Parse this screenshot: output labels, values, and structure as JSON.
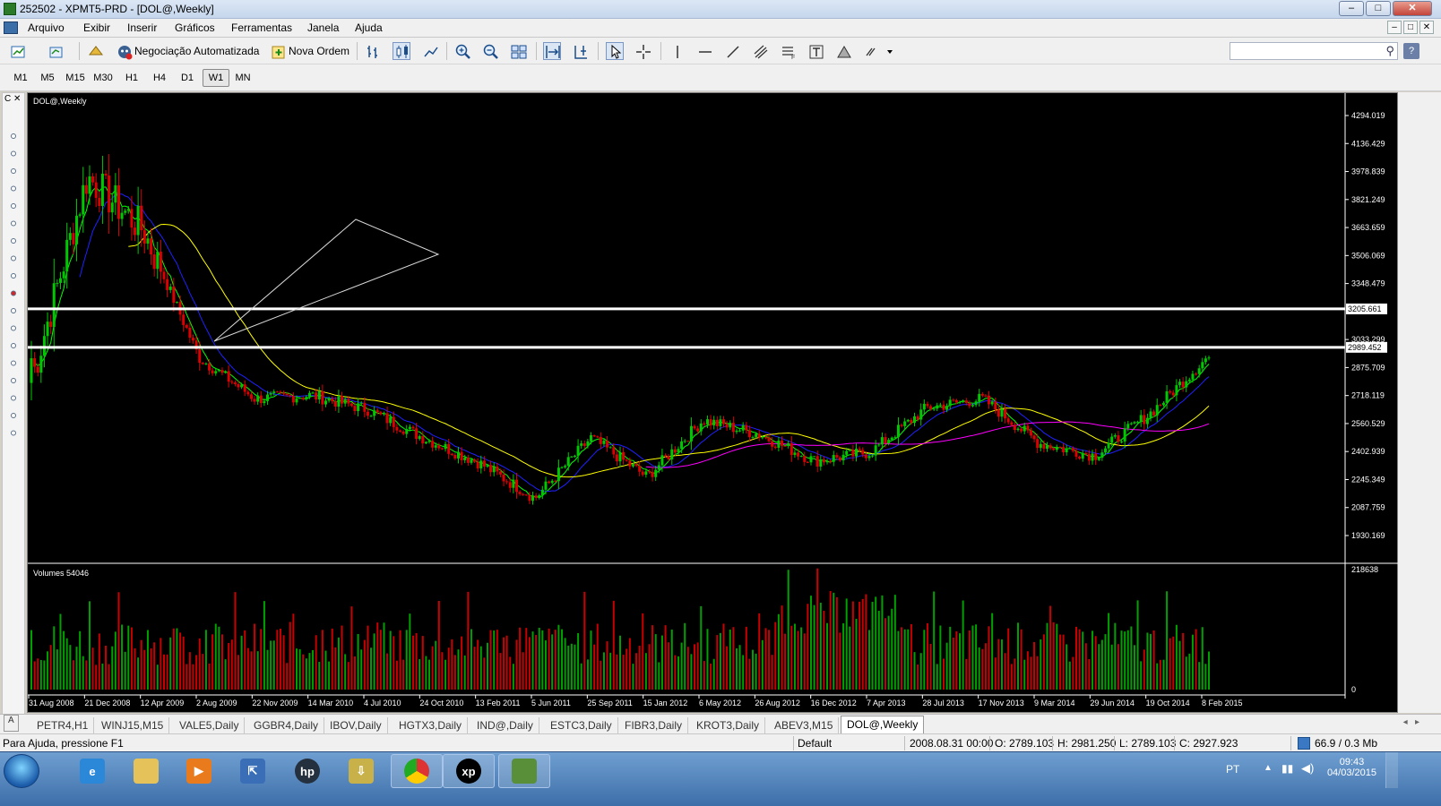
{
  "window": {
    "title": "252502 - XPMT5-PRD - [DOL@,Weekly]",
    "btn_minimize": "–",
    "btn_maximize": "□",
    "btn_close": "✕"
  },
  "menu": [
    "Arquivo",
    "Exibir",
    "Inserir",
    "Gráficos",
    "Ferramentas",
    "Janela",
    "Ajuda"
  ],
  "toolbar": {
    "auto_trading_label": "Negociação Automatizada",
    "new_order_label": "Nova Ordem",
    "search_placeholder": ""
  },
  "timeframes": [
    "M1",
    "M5",
    "M15",
    "M30",
    "H1",
    "H4",
    "D1",
    "W1",
    "MN"
  ],
  "active_timeframe": "W1",
  "chart": {
    "symbol_label": "DOL@,Weekly",
    "volume_label": "Volumes 54046",
    "price_ticks": [
      "4294.019",
      "4136.429",
      "3978.839",
      "3821.249",
      "3663.659",
      "3506.069",
      "3348.479",
      "3033.299",
      "2875.709",
      "2718.119",
      "2560.529",
      "2402.939",
      "2245.349",
      "2087.759",
      "1930.169"
    ],
    "price_tick_values": [
      4294.019,
      4136.429,
      3978.839,
      3821.249,
      3663.659,
      3506.069,
      3348.479,
      3033.299,
      2875.709,
      2718.119,
      2560.529,
      2402.939,
      2245.349,
      2087.759,
      1930.169
    ],
    "hline_labels": [
      "3205.661",
      "2989.452"
    ],
    "hline_values": [
      3205.661,
      2989.452
    ],
    "volume_max_label": "218638",
    "volume_min_label": "0",
    "date_labels": [
      "31 Aug 2008",
      "21 Dec 2008",
      "12 Apr 2009",
      "2 Aug 2009",
      "22 Nov 2009",
      "14 Mar 2010",
      "4 Jul 2010",
      "24 Oct 2010",
      "13 Feb 2011",
      "5 Jun 2011",
      "25 Sep 2011",
      "15 Jan 2012",
      "6 May 2012",
      "26 Aug 2012",
      "16 Dec 2012",
      "7 Apr 2013",
      "28 Jul 2013",
      "17 Nov 2013",
      "9 Mar 2014",
      "29 Jun 2014",
      "19 Oct 2014",
      "8 Feb 2015"
    ],
    "colors": {
      "background": "#000000",
      "bull": "#00c800",
      "bear": "#dc0000",
      "ma_fast": "#00ff00",
      "ma_mid": "#2020ff",
      "ma_slow": "#ffff00",
      "ma_long": "#ff00ff",
      "hline": "#ffffff",
      "volume_bull": "#00a000",
      "volume_bear": "#c80000"
    }
  },
  "chart_data": {
    "type": "candlestick",
    "symbol": "DOL@",
    "timeframe": "Weekly",
    "ylim": [
      1900,
      4400
    ],
    "anchor_closes": [
      {
        "date": "31 Aug 2008",
        "close": 2800
      },
      {
        "date": "21 Dec 2008",
        "close": 3950
      },
      {
        "date": "12 Apr 2009",
        "close": 3650
      },
      {
        "date": "2 Aug 2009",
        "close": 2930
      },
      {
        "date": "22 Nov 2009",
        "close": 2700
      },
      {
        "date": "14 Mar 2010",
        "close": 2720
      },
      {
        "date": "4 Jul 2010",
        "close": 2640
      },
      {
        "date": "24 Oct 2010",
        "close": 2480
      },
      {
        "date": "13 Feb 2011",
        "close": 2340
      },
      {
        "date": "5 Jun 2011",
        "close": 2140
      },
      {
        "date": "25 Sep 2011",
        "close": 2480
      },
      {
        "date": "15 Jan 2012",
        "close": 2260
      },
      {
        "date": "6 May 2012",
        "close": 2580
      },
      {
        "date": "26 Aug 2012",
        "close": 2500
      },
      {
        "date": "16 Dec 2012",
        "close": 2350
      },
      {
        "date": "7 Apr 2013",
        "close": 2400
      },
      {
        "date": "28 Jul 2013",
        "close": 2650
      },
      {
        "date": "17 Nov 2013",
        "close": 2700
      },
      {
        "date": "9 Mar 2014",
        "close": 2450
      },
      {
        "date": "29 Jun 2014",
        "close": 2380
      },
      {
        "date": "19 Oct 2014",
        "close": 2620
      },
      {
        "date": "8 Feb 2015",
        "close": 2930
      }
    ],
    "last_bar": {
      "time": "2008.08.31 00:00",
      "open": 2789.103,
      "high": 2981.25,
      "low": 2789.103,
      "close": 2927.923
    },
    "horizontal_lines": [
      3205.661,
      2989.452
    ],
    "volume_max": 218638
  },
  "tabs": [
    "PETR4,H1",
    "WINJ15,M15",
    "VALE5,Daily",
    "GGBR4,Daily",
    "IBOV,Daily",
    "HGTX3,Daily",
    "IND@,Daily",
    "ESTC3,Daily",
    "FIBR3,Daily",
    "KROT3,Daily",
    "ABEV3,M15",
    "DOL@,Weekly"
  ],
  "active_tab": "DOL@,Weekly",
  "status": {
    "help": "Para Ajuda, pressione F1",
    "profile": "Default",
    "time": "2008.08.31 00:00",
    "open": "O: 2789.103",
    "high": "H: 2981.250",
    "low": "L: 2789.103",
    "close": "C: 2927.923",
    "traffic": "66.9 / 0.3 Mb"
  },
  "taskbar": {
    "lang": "PT",
    "clock_time": "09:43",
    "clock_date": "04/03/2015",
    "xp_label": "xp"
  }
}
